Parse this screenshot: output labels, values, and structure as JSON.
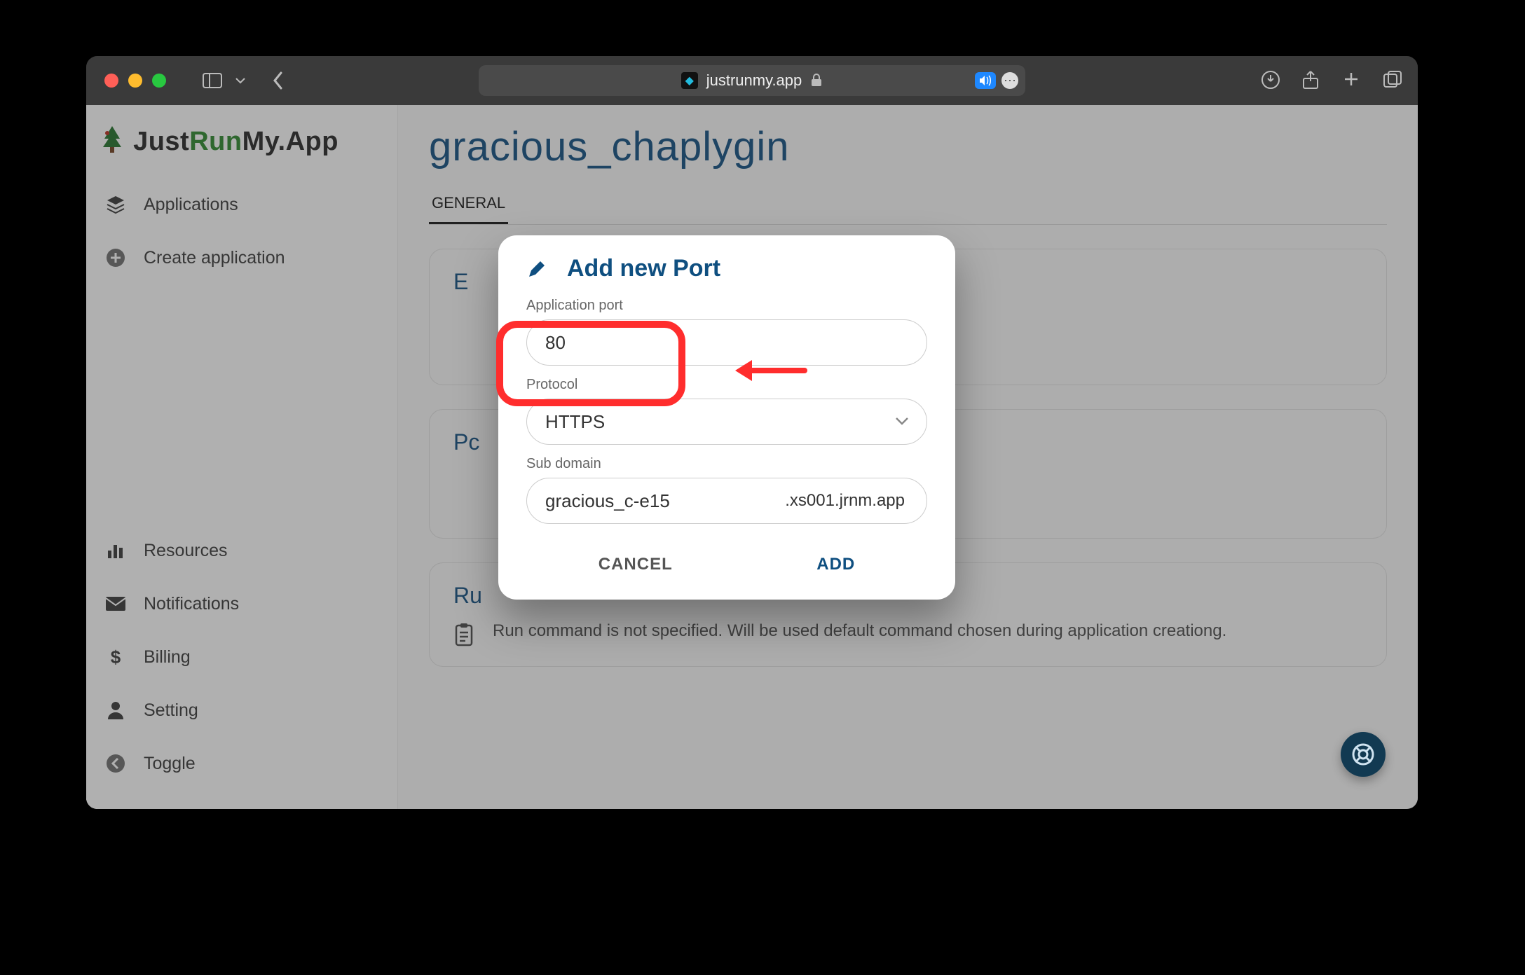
{
  "browser": {
    "url_display": "justrunmy.app"
  },
  "brand": {
    "part1": "Just",
    "part2": "Run",
    "part3": "My.",
    "part4": "App"
  },
  "sidebar": {
    "items": [
      {
        "label": "Applications",
        "icon": "layers-icon"
      },
      {
        "label": "Create application",
        "icon": "plus-circle-icon"
      }
    ],
    "lower": [
      {
        "label": "Resources",
        "icon": "bar-chart-icon"
      },
      {
        "label": "Notifications",
        "icon": "mail-icon"
      },
      {
        "label": "Billing",
        "icon": "dollar-icon"
      },
      {
        "label": "Setting",
        "icon": "person-icon"
      },
      {
        "label": "Toggle",
        "icon": "arrow-left-circle-icon"
      }
    ]
  },
  "page": {
    "title": "gracious_chaplygin",
    "tabs": {
      "active": "GENERAL"
    },
    "cards": {
      "env_title_visible_prefix": "E",
      "ports_title_visible_prefix": "Pc",
      "run_title_visible_prefix": "Ru",
      "run_note": "Run command is not specified. Will be used default command chosen during application creationg."
    }
  },
  "modal": {
    "title": "Add new Port",
    "fields": {
      "port_label": "Application port",
      "port_value": "80",
      "protocol_label": "Protocol",
      "protocol_value": "HTTPS",
      "subdomain_label": "Sub domain",
      "subdomain_value": "gracious_c-e15",
      "subdomain_suffix": ".xs001.jrnm.app"
    },
    "actions": {
      "cancel": "CANCEL",
      "add": "ADD"
    }
  }
}
